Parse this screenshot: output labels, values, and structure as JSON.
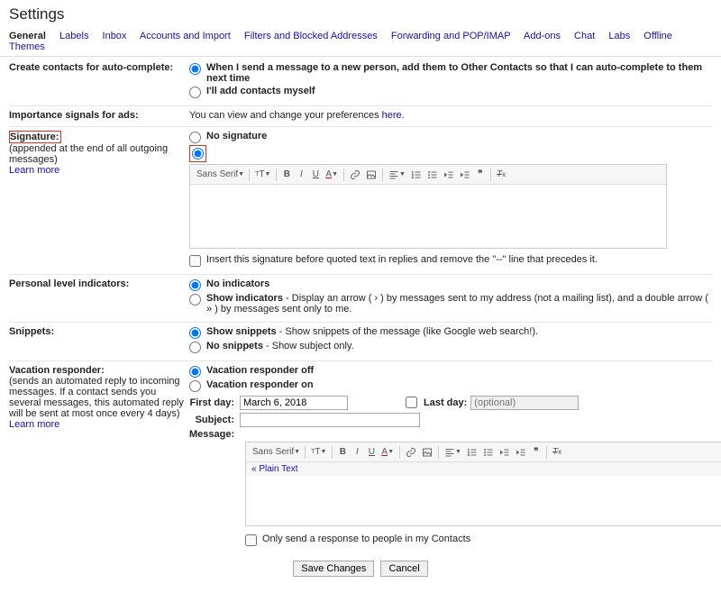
{
  "page": {
    "title": "Settings"
  },
  "tabs": {
    "general": "General",
    "labels": "Labels",
    "inbox": "Inbox",
    "accounts": "Accounts and Import",
    "filters": "Filters and Blocked Addresses",
    "forwarding": "Forwarding and POP/IMAP",
    "addons": "Add-ons",
    "chat": "Chat",
    "labs": "Labs",
    "offline": "Offline",
    "themes": "Themes"
  },
  "contacts": {
    "heading": "Create contacts for auto-complete:",
    "opt1": "When I send a message to a new person, add them to Other Contacts so that I can auto-complete to them next time",
    "opt2": "I'll add contacts myself"
  },
  "ads": {
    "heading": "Importance signals for ads:",
    "text": "You can view and change your preferences ",
    "link": "here"
  },
  "signature": {
    "heading": "Signature:",
    "desc": "(appended at the end of all outgoing messages)",
    "learn": "Learn more",
    "no_sig": "No signature",
    "insert_before": "Insert this signature before quoted text in replies and remove the \"--\" line that precedes it."
  },
  "toolbar": {
    "font": "Sans Serif"
  },
  "pli": {
    "heading": "Personal level indicators:",
    "opt1_b": "No indicators",
    "opt2_b": "Show indicators",
    "opt2_rest": " - Display an arrow ( › ) by messages sent to my address (not a mailing list), and a double arrow ( » ) by messages sent only to me."
  },
  "snippets": {
    "heading": "Snippets:",
    "opt1_b": "Show snippets",
    "opt1_rest": " - Show snippets of the message (like Google web search!).",
    "opt2_b": "No snippets",
    "opt2_rest": " - Show subject only."
  },
  "vacation": {
    "heading": "Vacation responder:",
    "desc": "(sends an automated reply to incoming messages. If a contact sends you several messages, this automated reply will be sent at most once every 4 days)",
    "learn": "Learn more",
    "off": "Vacation responder off",
    "on": "Vacation responder on",
    "first_day_label": "First day:",
    "first_day_value": "March 6, 2018",
    "last_day_label": "Last day:",
    "last_day_ph": "(optional)",
    "subject_label": "Subject:",
    "message_label": "Message:",
    "plain_text": "« Plain Text",
    "only_contacts": "Only send a response to people in my Contacts"
  },
  "buttons": {
    "save": "Save Changes",
    "cancel": "Cancel"
  },
  "dot": "."
}
